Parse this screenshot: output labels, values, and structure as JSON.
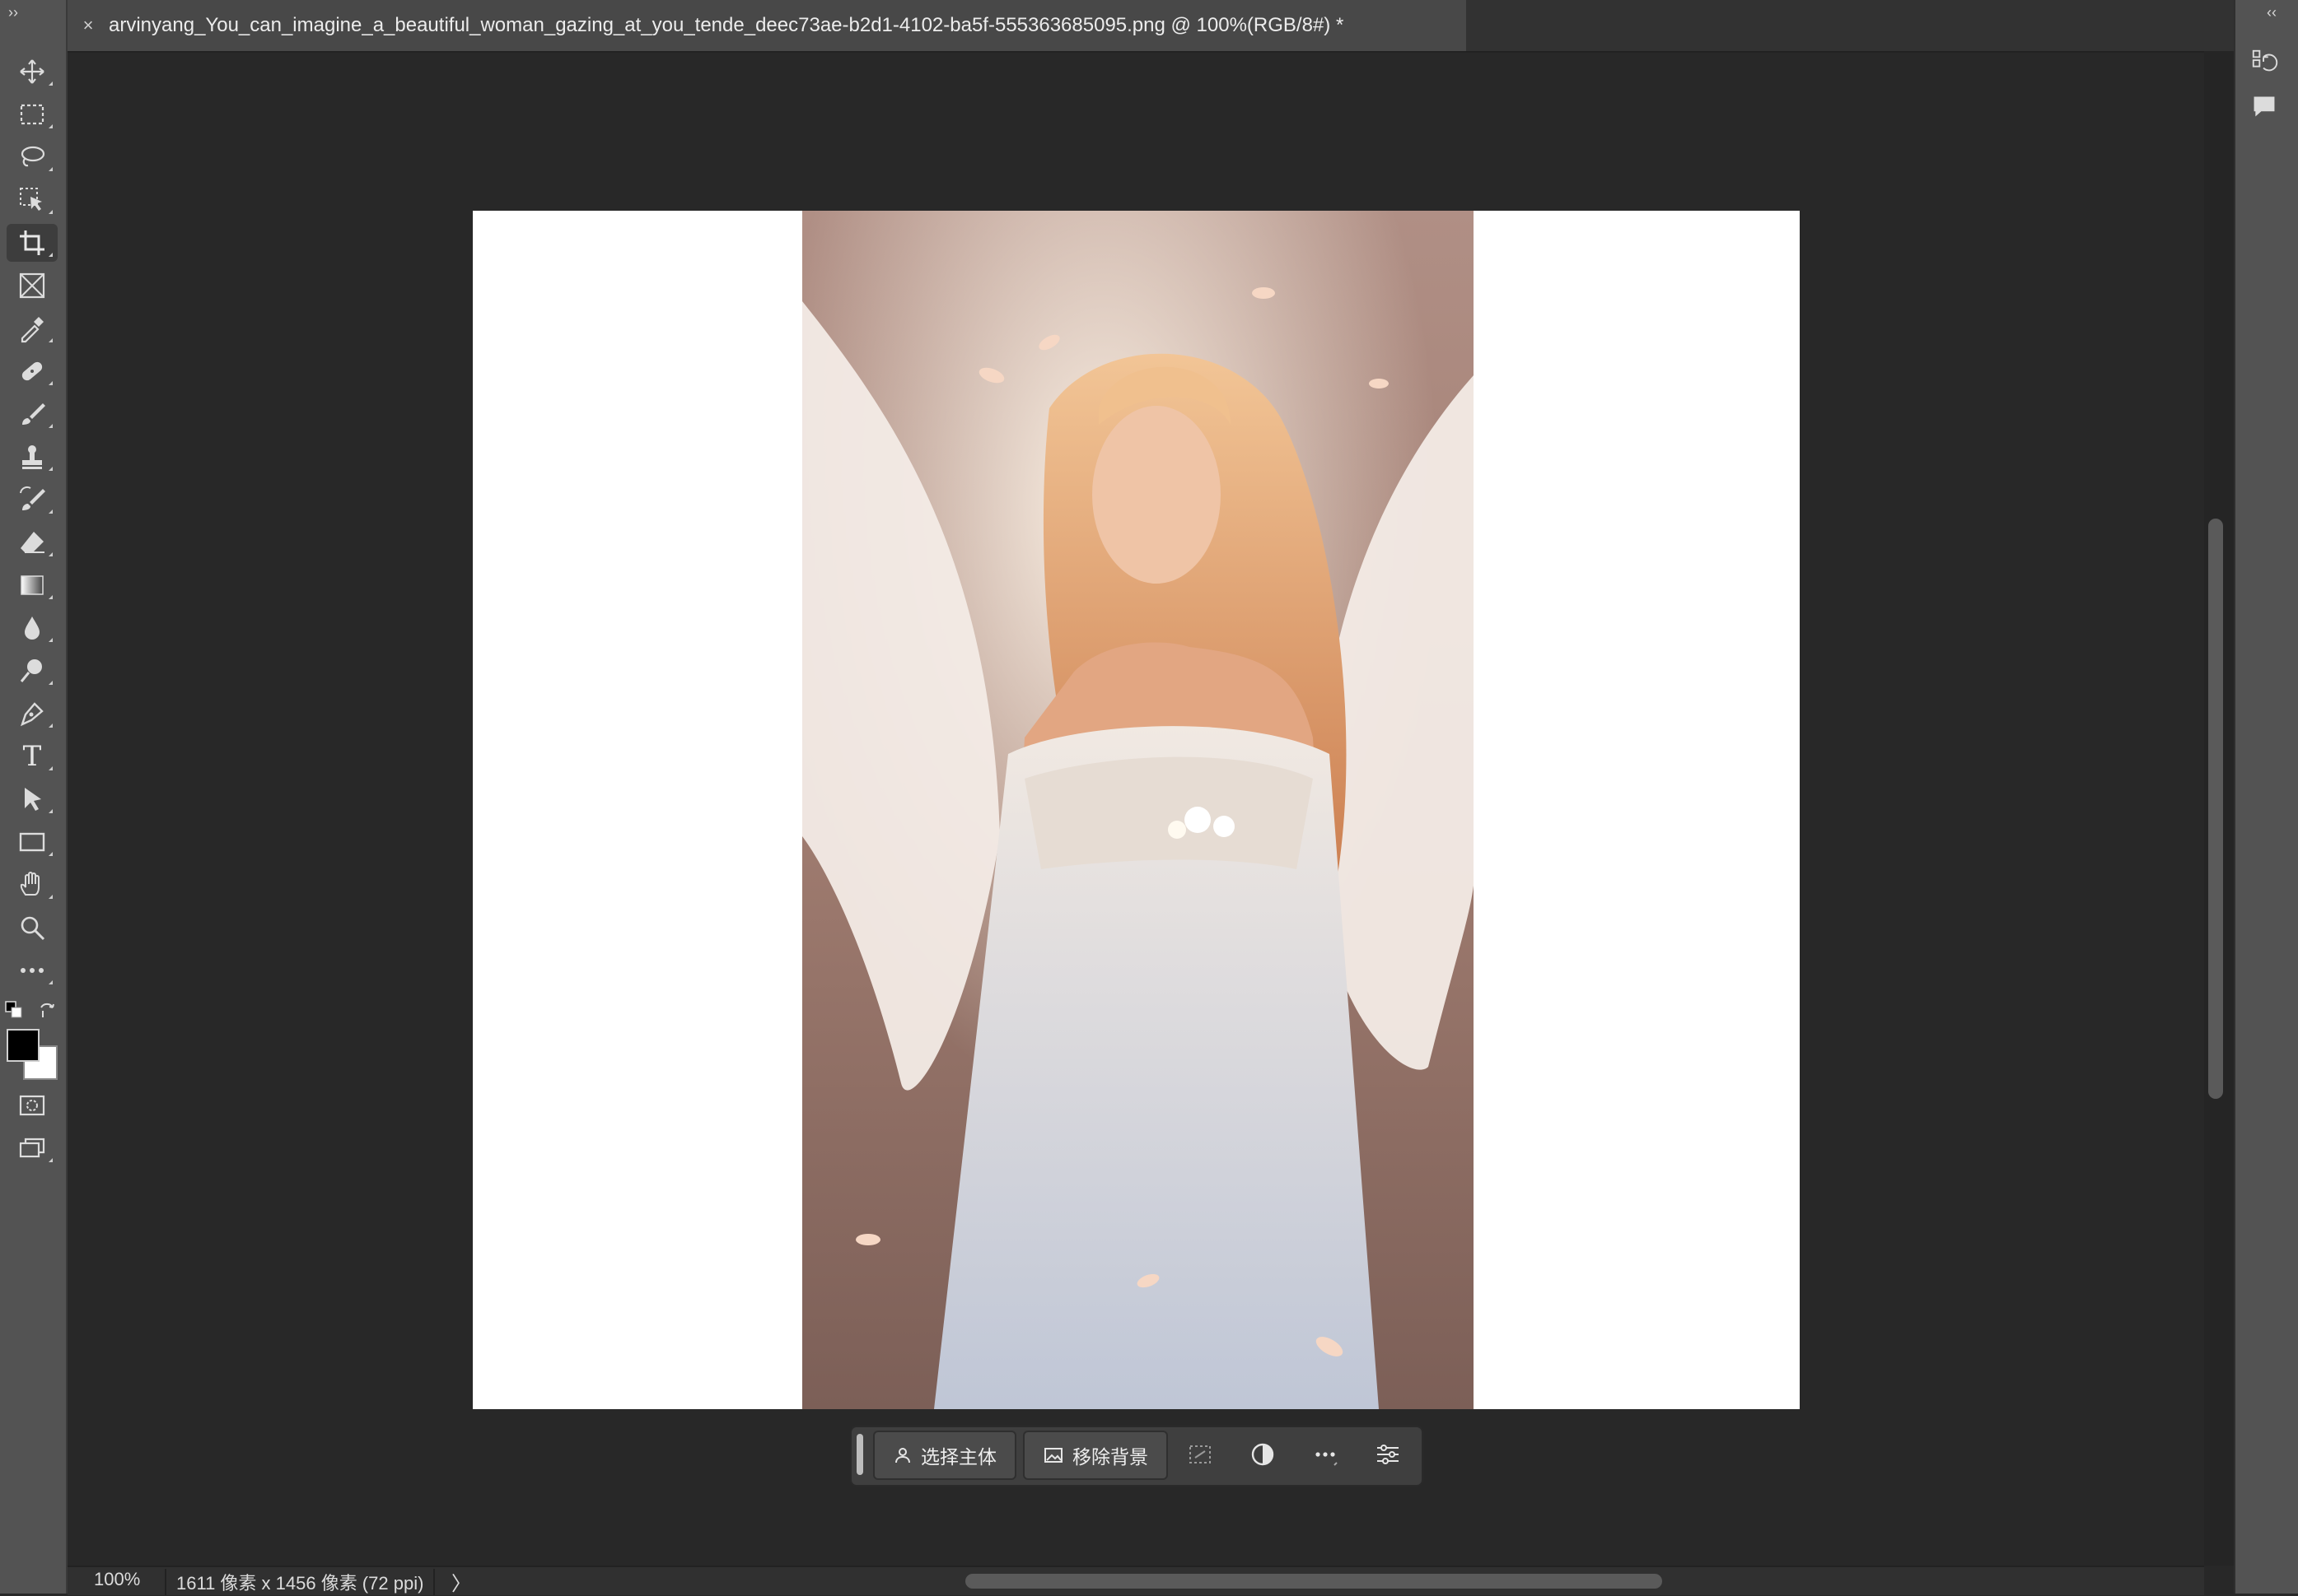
{
  "window": {
    "left_collapse": "››",
    "right_collapse": "‹‹"
  },
  "document_tab": {
    "close_symbol": "×",
    "title": "arvinyang_You_can_imagine_a_beautiful_woman_gazing_at_you_tende_deec73ae-b2d1-4102-ba5f-555363685095.png @ 100%(RGB/8#) *"
  },
  "toolbar": {
    "tools": [
      {
        "name": "move-tool",
        "icon": "move-icon"
      },
      {
        "name": "rectangular-marquee-tool",
        "icon": "marquee-icon"
      },
      {
        "name": "lasso-tool",
        "icon": "lasso-icon"
      },
      {
        "name": "object-selection-tool",
        "icon": "object-selection-icon"
      },
      {
        "name": "crop-tool",
        "icon": "crop-icon",
        "active": true
      },
      {
        "name": "frame-tool",
        "icon": "frame-icon"
      },
      {
        "name": "eyedropper-tool",
        "icon": "eyedropper-icon"
      },
      {
        "name": "healing-brush-tool",
        "icon": "bandage-icon"
      },
      {
        "name": "brush-tool",
        "icon": "brush-icon"
      },
      {
        "name": "clone-stamp-tool",
        "icon": "stamp-icon"
      },
      {
        "name": "history-brush-tool",
        "icon": "history-brush-icon"
      },
      {
        "name": "eraser-tool",
        "icon": "eraser-icon"
      },
      {
        "name": "gradient-tool",
        "icon": "gradient-icon"
      },
      {
        "name": "blur-tool",
        "icon": "droplet-icon"
      },
      {
        "name": "dodge-tool",
        "icon": "dodge-icon"
      },
      {
        "name": "pen-tool",
        "icon": "pen-icon"
      },
      {
        "name": "type-tool",
        "icon": "type-icon",
        "glyph": "T"
      },
      {
        "name": "path-selection-tool",
        "icon": "arrow-icon"
      },
      {
        "name": "rectangle-tool",
        "icon": "rectangle-icon"
      },
      {
        "name": "hand-tool",
        "icon": "hand-icon"
      },
      {
        "name": "zoom-tool",
        "icon": "magnifier-icon"
      },
      {
        "name": "edit-toolbar",
        "icon": "more-icon"
      }
    ],
    "foreground_color": "#000000",
    "background_color": "#ffffff"
  },
  "contextual_taskbar": {
    "select_subject_label": "选择主体",
    "remove_background_label": "移除背景"
  },
  "status_bar": {
    "zoom": "100%",
    "document_info": "1611 像素 x 1456 像素 (72 ppi)",
    "arrow": "〉"
  },
  "colors": {
    "toolbar_bg": "#535353",
    "workspace_bg": "#282828",
    "canvas_bg": "#ffffff"
  }
}
